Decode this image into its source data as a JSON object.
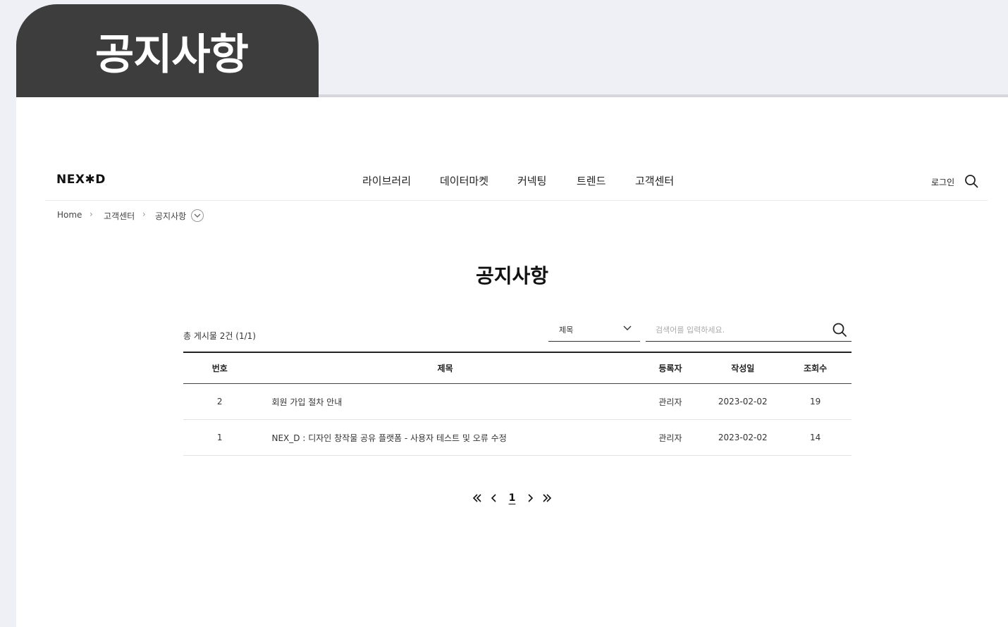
{
  "banner": {
    "title": "공지사항"
  },
  "header": {
    "logo": "NEX✱D",
    "nav": [
      "라이브러리",
      "데이터마켓",
      "커넥팅",
      "트렌드",
      "고객센터"
    ],
    "login": "로그인"
  },
  "breadcrumb": {
    "home": "Home",
    "sep": "›",
    "level1": "고객센터",
    "level2": "공지사항"
  },
  "content": {
    "title": "공지사항"
  },
  "board": {
    "total": "총 게시물 2건 (1/1)",
    "search_field_selected": "제목",
    "search_placeholder": "검색어를 입력하세요.",
    "columns": {
      "no": "번호",
      "title": "제목",
      "writer": "등록자",
      "date": "작성일",
      "views": "조회수"
    },
    "rows": [
      {
        "no": "2",
        "title": "회원 가입 절차 안내",
        "writer": "관리자",
        "date": "2023-02-02",
        "views": "19"
      },
      {
        "no": "1",
        "title": "NEX_D : 디자인 창작물 공유 플랫폼 - 사용자 테스트 및 오류 수정",
        "writer": "관리자",
        "date": "2023-02-02",
        "views": "14"
      }
    ]
  },
  "pagination": {
    "current_page": "1"
  }
}
